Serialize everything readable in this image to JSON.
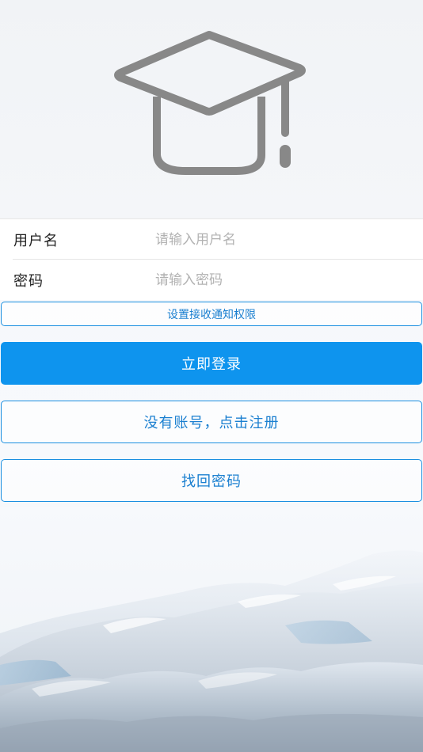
{
  "logo": {
    "icon": "graduation-cap-icon",
    "color": "#888888"
  },
  "form": {
    "username": {
      "label": "用户名",
      "placeholder": "请输入用户名",
      "value": ""
    },
    "password": {
      "label": "密码",
      "placeholder": "请输入密码",
      "value": ""
    }
  },
  "buttons": {
    "notification_permission": "设置接收通知权限",
    "login": "立即登录",
    "register": "没有账号，点击注册",
    "recover_password": "找回密码"
  },
  "colors": {
    "accent": "#0e94ee",
    "outline": "#1b8fe0",
    "outline_text": "#1a7fd0",
    "placeholder": "#b2b2b2"
  },
  "background": {
    "scene": "snowy-mountains-image"
  }
}
